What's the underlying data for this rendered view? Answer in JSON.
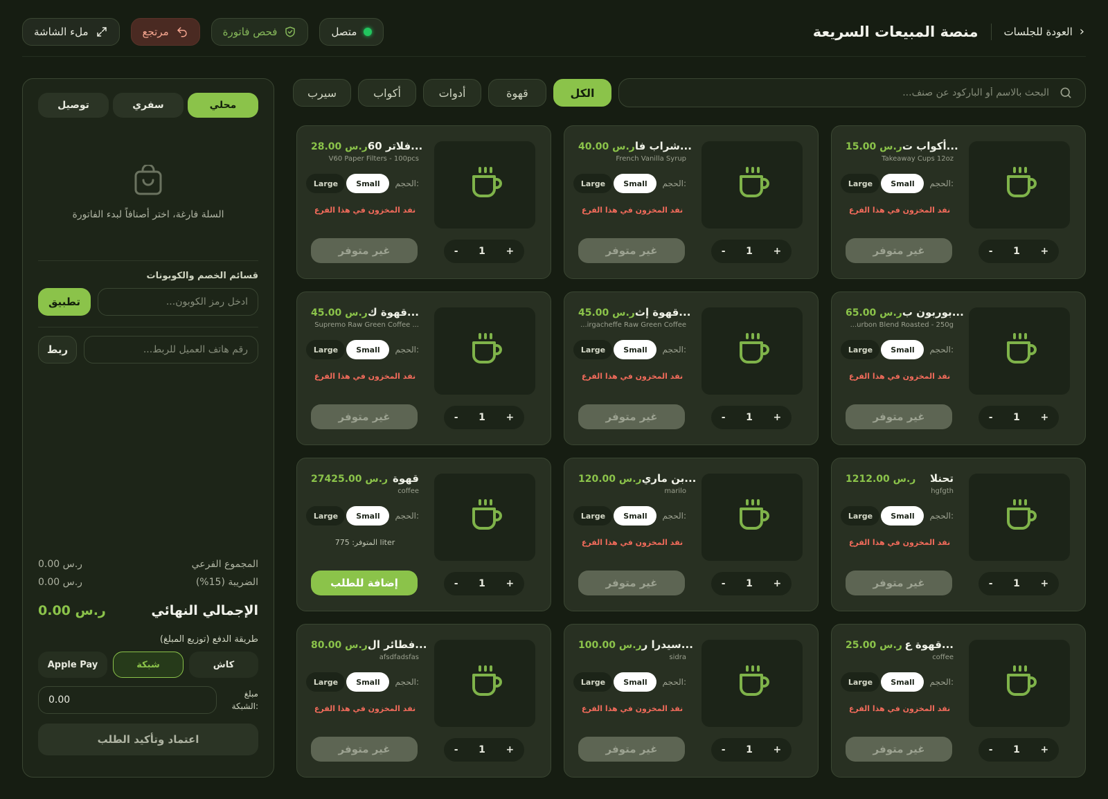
{
  "header": {
    "back_label": "العودة للجلسات",
    "title": "منصة المبيعات السريعة",
    "status_label": "متصل",
    "check_invoice_label": "فحص فاتورة",
    "refund_label": "مرتجع",
    "fullscreen_label": "ملء الشاشة"
  },
  "search": {
    "placeholder": "البحث بالاسم أو الباركود عن صنف..."
  },
  "categories": [
    "الكل",
    "قهوة",
    "أدوات",
    "أكواب",
    "سيرب"
  ],
  "active_category": "الكل",
  "products": [
    {
      "name": "أكواب ت...",
      "price": "15.00 ر.س",
      "subtitle": "Takeaway Cups 12oz",
      "size_label": "الحجم:",
      "size_small": "Small",
      "size_large": "Large",
      "stock": "نفد المخزون في هذا الفرع",
      "qty": "1",
      "action": "غير متوفر"
    },
    {
      "name": "شراب فا...",
      "price": "40.00 ر.س",
      "subtitle": "French Vanilla Syrup",
      "size_label": "الحجم:",
      "size_small": "Small",
      "size_large": "Large",
      "stock": "نفد المخزون في هذا الفرع",
      "qty": "1",
      "action": "غير متوفر"
    },
    {
      "name": "فلاتر 60...",
      "price": "28.00 ر.س",
      "subtitle": "V60 Paper Filters - 100pcs",
      "size_label": "الحجم:",
      "size_small": "Small",
      "size_large": "Large",
      "stock": "نفد المخزون في هذا الفرع",
      "qty": "1",
      "action": "غير متوفر"
    },
    {
      "name": "بوربون ب...",
      "price": "65.00 ر.س",
      "subtitle": "...urbon Blend Roasted - 250g",
      "size_label": "الحجم:",
      "size_small": "Small",
      "size_large": "Large",
      "stock": "نفد المخزون في هذا الفرع",
      "qty": "1",
      "action": "غير متوفر"
    },
    {
      "name": "قهوة إث...",
      "price": "45.00 ر.س",
      "subtitle": "...irgacheffe Raw Green Coffee",
      "size_label": "الحجم:",
      "size_small": "Small",
      "size_large": "Large",
      "stock": "نفد المخزون في هذا الفرع",
      "qty": "1",
      "action": "غير متوفر"
    },
    {
      "name": "قهوة ك...",
      "price": "45.00 ر.س",
      "subtitle": "Supremo Raw Green Coffee ...",
      "size_label": "الحجم:",
      "size_small": "Small",
      "size_large": "Large",
      "stock": "نفد المخزون في هذا الفرع",
      "qty": "1",
      "action": "غير متوفر"
    },
    {
      "name": "تحنلا",
      "price": "1212.00 ر.س",
      "subtitle": "hgfgth",
      "size_label": "الحجم:",
      "size_small": "Small",
      "size_large": "Large",
      "stock": "نفد المخزون في هذا الفرع",
      "qty": "1",
      "action": "غير متوفر"
    },
    {
      "name": "بن ماري...",
      "price": "120.00 ر.س",
      "subtitle": "marilo",
      "size_label": "الحجم:",
      "size_small": "Small",
      "size_large": "Large",
      "stock": "نفد المخزون في هذا الفرع",
      "qty": "1",
      "action": "غير متوفر"
    },
    {
      "name": "قهوة",
      "price": "27425.00 ر.س",
      "subtitle": "coffee",
      "size_label": "الحجم:",
      "size_small": "Small",
      "size_large": "Large",
      "stock": "المتوفر: 775 liter",
      "in_stock": true,
      "qty": "1",
      "action": "إضافة للطلب"
    },
    {
      "name": "قهوة ع...",
      "price": "25.00 ر.س",
      "subtitle": "coffee",
      "size_label": "الحجم:",
      "size_small": "Small",
      "size_large": "Large",
      "stock": "نفد المخزون في هذا الفرع",
      "qty": "1",
      "action": "غير متوفر"
    },
    {
      "name": "سيدرا ر...",
      "price": "100.00 ر.س",
      "subtitle": "sidra",
      "size_label": "الحجم:",
      "size_small": "Small",
      "size_large": "Large",
      "stock": "نفد المخزون في هذا الفرع",
      "qty": "1",
      "action": "غير متوفر"
    },
    {
      "name": "فطائر ال...",
      "price": "80.00 ر.س",
      "subtitle": "afsdfadsfas",
      "size_label": "الحجم:",
      "size_small": "Small",
      "size_large": "Large",
      "stock": "نفد المخزون في هذا الفرع",
      "qty": "1",
      "action": "غير متوفر"
    }
  ],
  "order": {
    "tabs": [
      "محلي",
      "سفري",
      "توصيل"
    ],
    "active_tab": "محلي",
    "empty_message": "السلة فارغة، اختر أصنافاً لبدء الفاتورة",
    "discounts_title": "قسائم الخصم والكوبونات",
    "coupon_placeholder": "ادخل رمز الكوبون...",
    "apply_label": "تطبيق",
    "phone_placeholder": "رقم هاتف العميل للربط...",
    "link_label": "ربط",
    "subtotal_label": "المجموع الفرعي",
    "subtotal_value": "0.00 ر.س",
    "tax_label": "الضريبة (15%)",
    "tax_value": "0.00 ر.س",
    "total_label": "الإجمالي النهائي",
    "total_value": "0.00 ر.س",
    "payment_title": "طريقة الدفع (توزيع المبلغ)",
    "payment_methods": [
      "كاش",
      "شبكة",
      "Apple Pay"
    ],
    "active_payment": "شبكة",
    "amount_label_1": "مبلغ",
    "amount_label_2": "الشبكة:",
    "amount_value": "0.00",
    "confirm_label": "اعتماد وتأكيد الطلب"
  },
  "icons": {
    "product": "coffee-cup-icon",
    "cart": "shopping-bag-icon",
    "search": "search-icon",
    "back": "chevron-right-icon",
    "check": "shield-check-icon",
    "refund": "undo-arrow-icon",
    "fullscreen": "expand-icon"
  },
  "colors": {
    "accent": "#8bc34a",
    "online": "#22c55e",
    "out_of_stock": "#f26b5b",
    "refund": "#f5a58f"
  }
}
